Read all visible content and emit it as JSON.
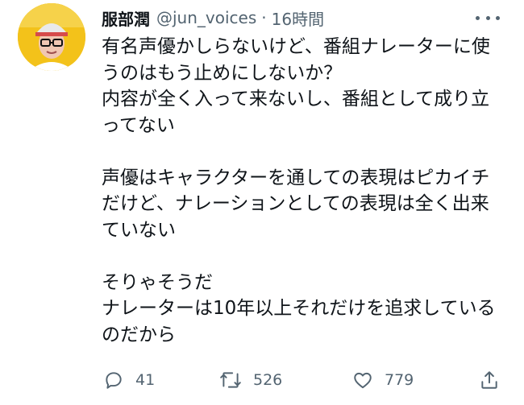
{
  "tweet": {
    "display_name": "服部潤",
    "handle": "@jun_voices",
    "separator": "·",
    "time": "16時間",
    "text_lines": [
      "有名声優かしらないけど、番組ナレーターに使",
      "うのはもう止めにしないか？",
      "内容が全く入って来ないし、番組として成り立",
      "ってない",
      "",
      "声優はキャラクターを通しての表現はピカイチ",
      "だけど、ナレーションとしての表現は全く出来",
      "ていない",
      "",
      "そりゃそうだ",
      "ナレーターは10年以上それだけを追求している",
      "のだから"
    ],
    "actions": {
      "reply": {
        "icon": "reply-icon",
        "count": "41"
      },
      "retweet": {
        "icon": "retweet-icon",
        "count": "526"
      },
      "like": {
        "icon": "heart-icon",
        "count": "779"
      },
      "share": {
        "icon": "share-icon"
      }
    }
  },
  "colors": {
    "text": "#0f1419",
    "secondary": "#536471",
    "avatar_bg": "#f3c21a"
  }
}
